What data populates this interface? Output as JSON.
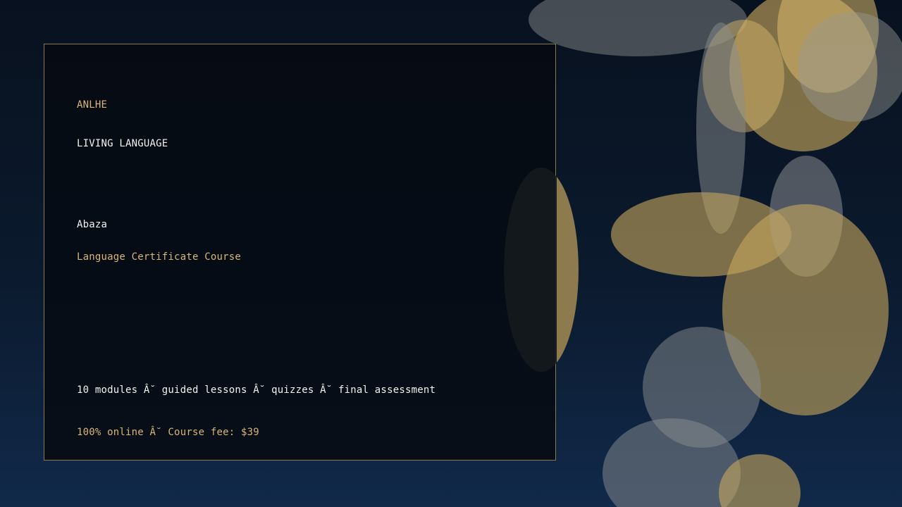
{
  "brand": "ANLHE",
  "kicker": "LIVING LANGUAGE",
  "language": "Abaza",
  "course_title": "Language Certificate Course",
  "details": "10 modules Â˘ guided lessons Â˘ quizzes Â˘ final assessment",
  "fee_line": "100% online Â˘ Course fee: $39",
  "colors": {
    "accent_gold": "#d9b675",
    "text_white": "#f2f2ef",
    "background": "#08111f",
    "card_border": "#8a7a52"
  }
}
